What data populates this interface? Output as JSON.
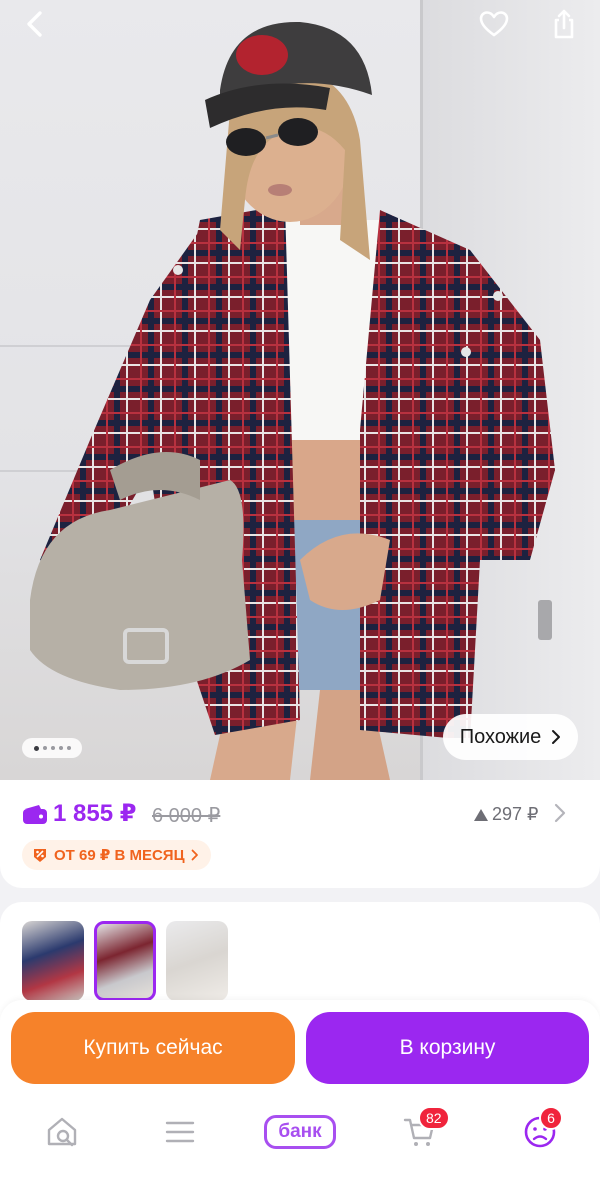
{
  "product": {
    "similar_label": "Похожие",
    "gallery_dots": 5,
    "gallery_active_index": 0
  },
  "price": {
    "current": "1 855 ₽",
    "old": "6 000 ₽",
    "change": "297 ₽",
    "installment": "ОТ 69 ₽ В МЕСЯЦ"
  },
  "thumbnails": [
    {
      "name": "thumb-blue-plaid"
    },
    {
      "name": "thumb-red-plaid",
      "selected": true
    },
    {
      "name": "thumb-light"
    }
  ],
  "actions": {
    "buy_now": "Купить сейчас",
    "add_to_cart": "В корзину"
  },
  "bottom_nav": {
    "bank_label": "банк",
    "cart_badge": "82",
    "profile_badge": "6"
  },
  "colors": {
    "accent_purple": "#9b27f0",
    "accent_orange": "#f6822a",
    "badge_red": "#f0243c"
  }
}
